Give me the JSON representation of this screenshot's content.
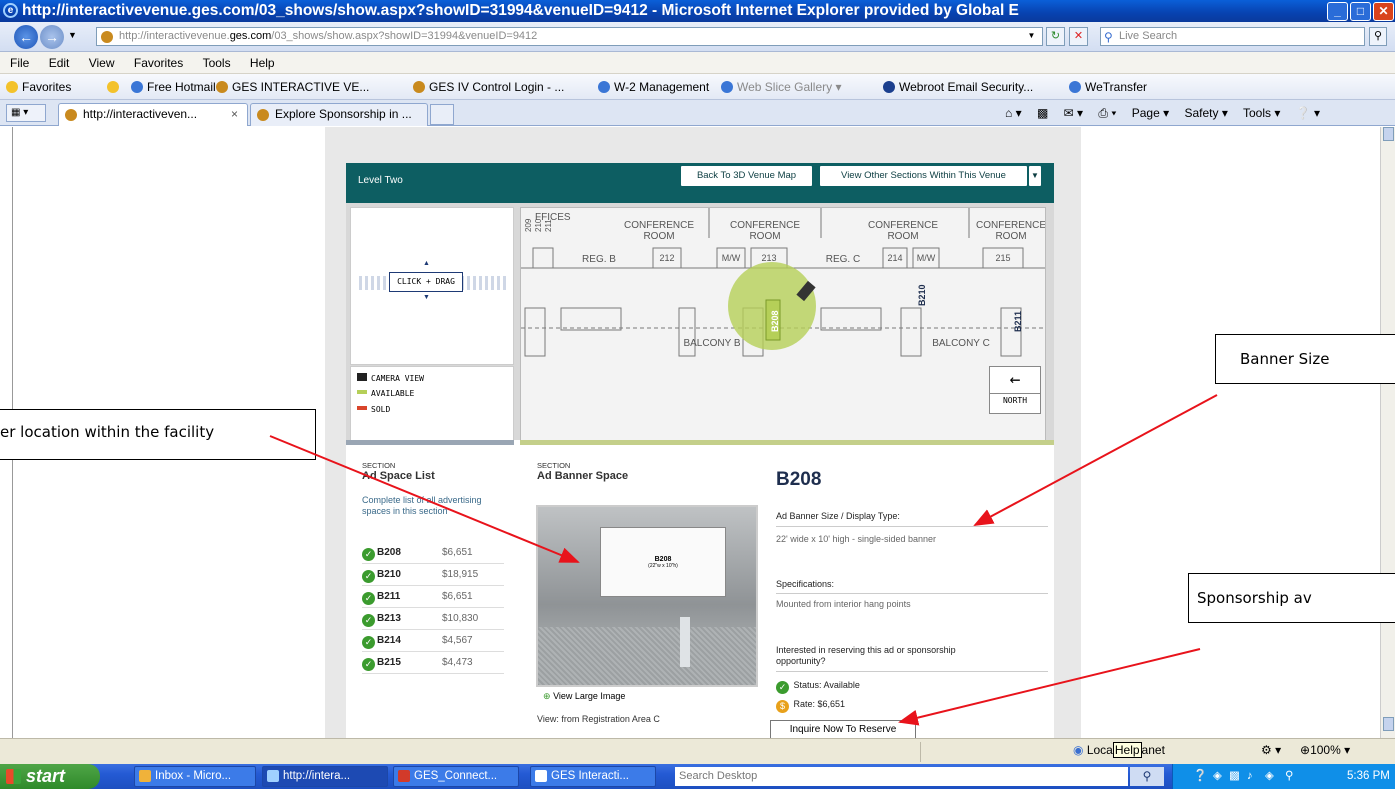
{
  "window": {
    "title": "http://interactivevenue.ges.com/03_shows/show.aspx?showID=31994&venueID=9412 - Microsoft Internet Explorer provided by Global E"
  },
  "address": {
    "prefix": "http://interactivevenue.",
    "domain": "ges.com",
    "suffix": "/03_shows/show.aspx?showID=31994&venueID=9412",
    "search_placeholder": "Live Search"
  },
  "menu": [
    "File",
    "Edit",
    "View",
    "Favorites",
    "Tools",
    "Help"
  ],
  "favorites": {
    "label": "Favorites",
    "items": [
      "Free Hotmail",
      "GES  INTERACTIVE VE...",
      "GES IV Control Login - ...",
      "W-2 Management",
      "Web Slice Gallery ▾",
      "Webroot Email Security...",
      "WeTransfer"
    ]
  },
  "tabs": [
    "http://interactiveven...",
    "Explore Sponsorship in ..."
  ],
  "commandbar": [
    "Page ▾",
    "Safety ▾",
    "Tools ▾"
  ],
  "site": {
    "level": "Level Two",
    "back_button": "Back To 3D Venue Map",
    "other_sections_button": "View Other Sections Within This Venue",
    "minimap_label": "CLICK + DRAG",
    "legend": [
      "CAMERA VIEW",
      "AVAILABLE",
      "SOLD"
    ],
    "north": "NORTH",
    "map_labels": {
      "offices": "FFICES",
      "conference": "CONFERENCE",
      "room": "ROOM",
      "reg_b": "REG. B",
      "reg_c": "REG. C",
      "balcony_b": "BALCONY B",
      "balcony_c": "BALCONY C",
      "rooms": [
        "212",
        "213",
        "214",
        "215"
      ],
      "mw": "M/W",
      "side_rooms": [
        "209",
        "210",
        "211"
      ],
      "b208": "B208",
      "b210": "B210",
      "b211": "B211"
    },
    "list_section_label": "SECTION",
    "list_heading": "Ad Space List",
    "list_desc": "Complete list of all advertising spaces in this section",
    "ad_spaces": [
      {
        "code": "B208",
        "price": "$6,651"
      },
      {
        "code": "B210",
        "price": "$18,915"
      },
      {
        "code": "B211",
        "price": "$6,651"
      },
      {
        "code": "B213",
        "price": "$10,830"
      },
      {
        "code": "B214",
        "price": "$4,567"
      },
      {
        "code": "B215",
        "price": "$4,473"
      }
    ],
    "detail_section_label": "SECTION",
    "detail_heading": "Ad Banner Space",
    "photo_banner_code": "B208",
    "photo_banner_size": "(22\"w x 10\"h)",
    "view_large": "View Large Image",
    "view_from": "View: from Registration Area C",
    "space_code": "B208",
    "banner_size_label": "Ad Banner Size / Display Type:",
    "banner_size_value": "22' wide x 10' high - single-sided banner",
    "specs_label": "Specifications:",
    "specs_value": "Mounted from interior hang points",
    "interest_text": "Interested in reserving this ad or sponsorship opportunity?",
    "status": "Status: Available",
    "rate": "Rate: $6,651",
    "inquire_button": "Inquire Now To Reserve"
  },
  "callouts": {
    "location": "er location within the facility",
    "banner_size": "Banner Size",
    "sponsorship": "Sponsorship av"
  },
  "statusbar": {
    "zone": "Loca",
    "help_tip": "Help",
    "zone_rest": "anet",
    "zoom": "100%"
  },
  "taskbar": {
    "start": "start",
    "tasks": [
      "Inbox - Micro...",
      "http://intera...",
      "GES_Connect...",
      "GES Interacti..."
    ],
    "search_placeholder": "Search Desktop",
    "clock": "5:36 PM"
  },
  "colors": {
    "site_teal": "#0d5e62",
    "available_green": "#b5cf58",
    "sold_red": "#d9452b",
    "arrow_red": "#e8131b"
  }
}
